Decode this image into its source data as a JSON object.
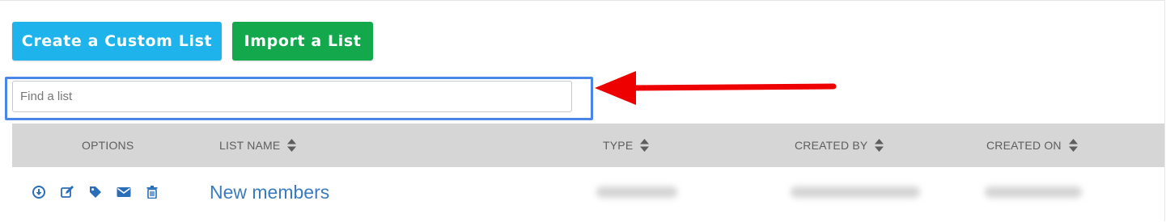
{
  "toolbar": {
    "create_label": "Create a Custom List",
    "import_label": "Import a List"
  },
  "search": {
    "placeholder": "Find a list",
    "value": ""
  },
  "table": {
    "columns": [
      "OPTIONS",
      "LIST NAME",
      "TYPE",
      "CREATED BY",
      "CREATED ON"
    ],
    "rows": [
      {
        "list_name": "New members",
        "options": [
          "download-icon",
          "edit-icon",
          "tag-icon",
          "envelope-icon",
          "trash-icon"
        ]
      }
    ]
  },
  "colors": {
    "create_button": "#1eb3ea",
    "import_button": "#14a84c",
    "highlight_border": "#4a86e8",
    "annotation_arrow": "#ee0000",
    "header_background": "#d6d6d6",
    "link": "#3a7bbf"
  }
}
